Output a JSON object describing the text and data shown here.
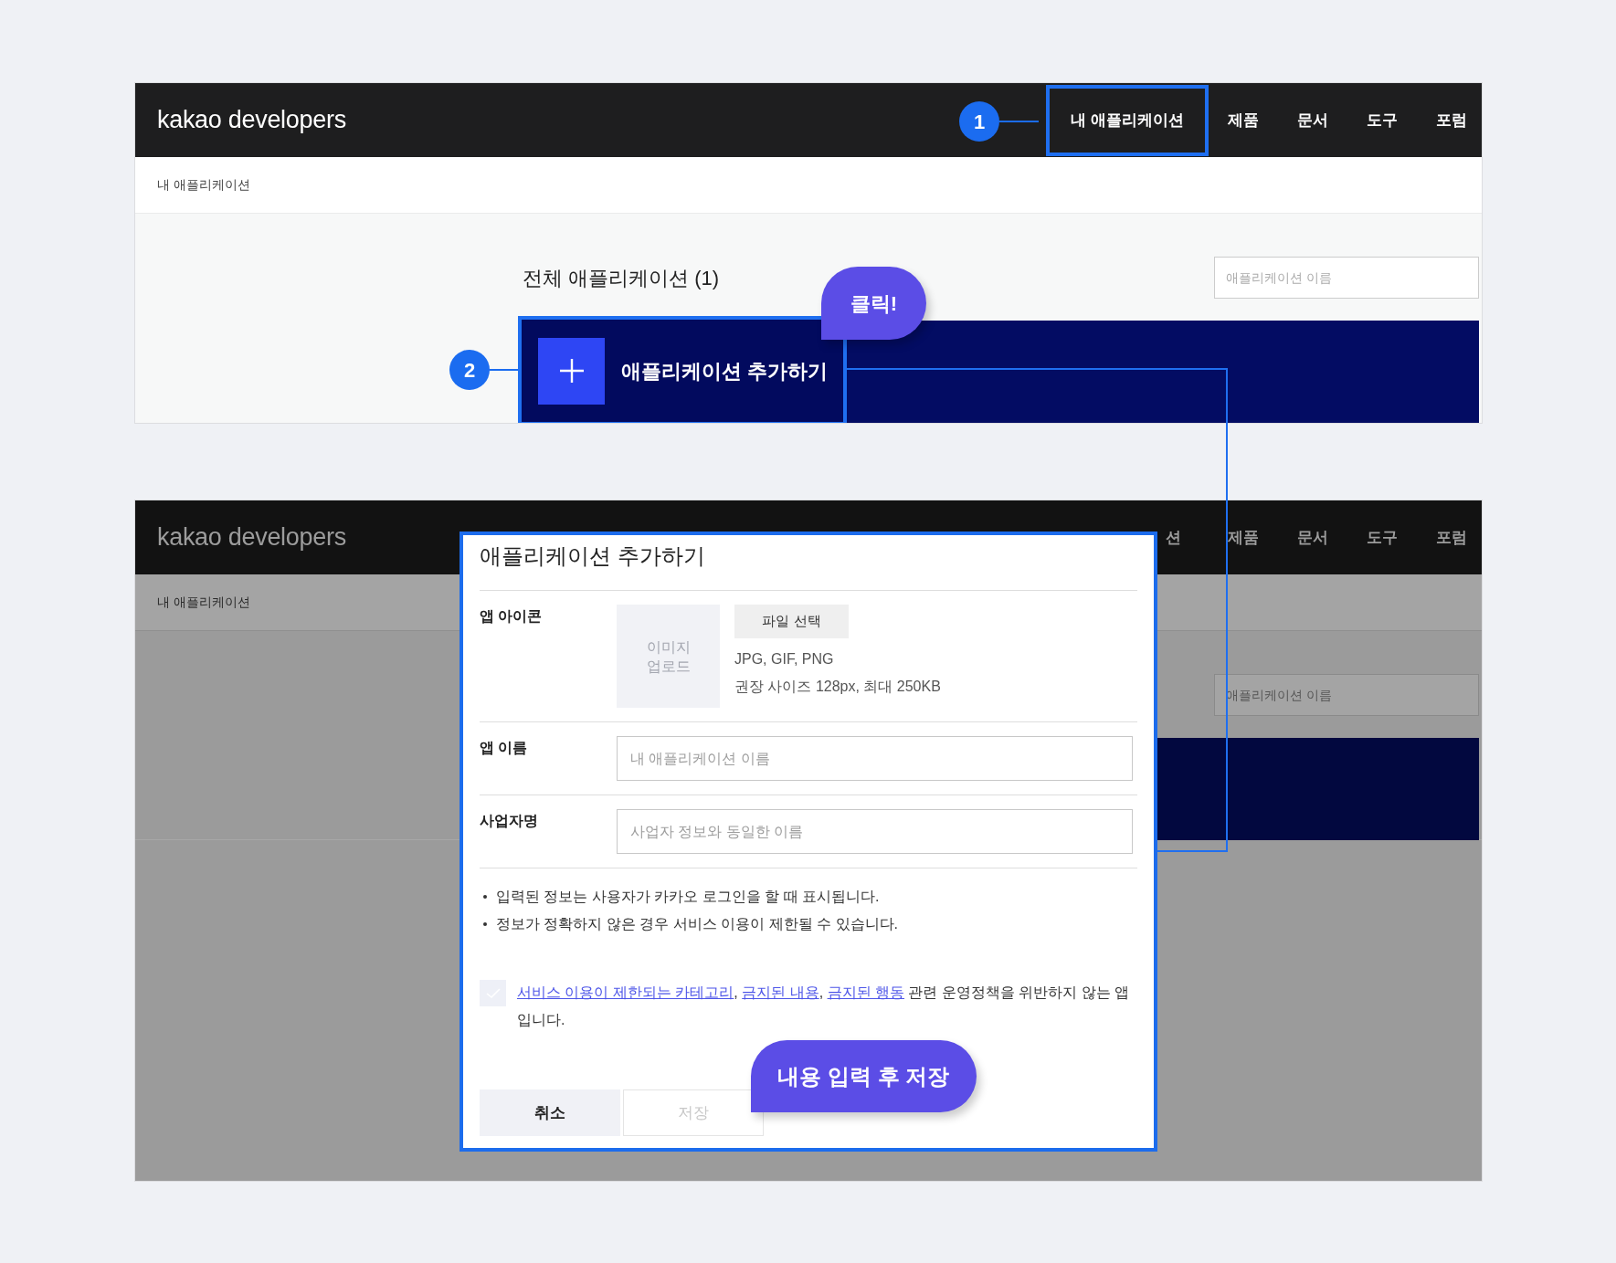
{
  "step_1": {
    "header": {
      "logo": "kakao developers",
      "nav": [
        {
          "label": "내 애플리케이션",
          "highlighted": true
        },
        {
          "label": "제품",
          "highlighted": false
        },
        {
          "label": "문서",
          "highlighted": false
        },
        {
          "label": "도구",
          "highlighted": false
        },
        {
          "label": "포럼",
          "highlighted": false
        }
      ]
    },
    "breadcrumb": "내 애플리케이션",
    "heading": "전체 애플리케이션 (1)",
    "search": {
      "placeholder": "애플리케이션 이름"
    },
    "add_button": {
      "label": "애플리케이션 추가하기",
      "highlighted": true
    }
  },
  "step_2": {
    "header": {
      "logo": "kakao developers",
      "nav": [
        {
          "label": "션"
        },
        {
          "label": "제품"
        },
        {
          "label": "문서"
        },
        {
          "label": "도구"
        },
        {
          "label": "포럼"
        }
      ]
    },
    "breadcrumb": "내 애플리케이션",
    "search": {
      "placeholder": "애플리케이션 이름"
    },
    "dialog": {
      "title": "애플리케이션 추가하기",
      "icon_label": "앱 아이콘",
      "upload_box": "이미지 업로드",
      "file_button": "파일 선택",
      "formats": "JPG, GIF, PNG",
      "size_hint": "권장 사이즈 128px, 최대 250KB",
      "fields": [
        {
          "label": "앱 이름",
          "placeholder": "내 애플리케이션 이름"
        },
        {
          "label": "사업자명",
          "placeholder": "사업자 정보와 동일한 이름"
        }
      ],
      "notes": [
        "입력된 정보는 사용자가 카카오 로그인을 할 때 표시됩니다.",
        "정보가 정확하지 않은 경우 서비스 이용이 제한될 수 있습니다."
      ],
      "agreement": {
        "checked": false,
        "parts": [
          {
            "kind": "link",
            "text": "서비스 이용이 제한되는 카테고리"
          },
          {
            "kind": "text",
            "text": ", "
          },
          {
            "kind": "link",
            "text": "금지된 내용"
          },
          {
            "kind": "text",
            "text": ", "
          },
          {
            "kind": "link",
            "text": "금지된 행동"
          },
          {
            "kind": "text",
            "text": " 관련 운영정책을 위반하지 않는 앱 입니다."
          }
        ]
      },
      "buttons": [
        {
          "label": "취소",
          "disabled": false
        },
        {
          "label": "저장",
          "disabled": true
        }
      ]
    }
  },
  "markers": [
    {
      "label": "1"
    },
    {
      "label": "2"
    }
  ],
  "callouts": [
    {
      "text": "클릭!"
    },
    {
      "text": "내용 입력 후 저장"
    }
  ]
}
